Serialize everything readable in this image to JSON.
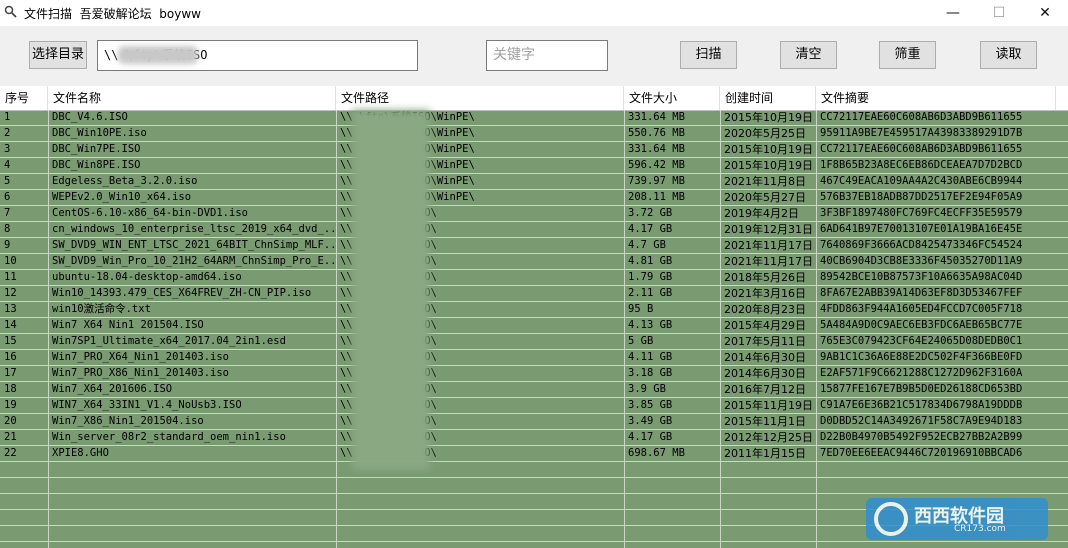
{
  "window": {
    "title": "文件扫描  吾爱破解论坛  boyww",
    "minimize": "—",
    "maximize": "☐",
    "close": "✕"
  },
  "toolbar": {
    "select_dir": "选择目录",
    "path_value": "\\\\            \\ftp\\系统ISO",
    "keyword_placeholder": "关键字",
    "scan": "扫描",
    "clear": "清空",
    "filter": "筛重",
    "read": "读取"
  },
  "table": {
    "columns": [
      "序号",
      "文件名称",
      "文件路径",
      "文件大小",
      "创建时间",
      "文件摘要"
    ],
    "rows": [
      [
        "1",
        "DBC_V4.6.ISO",
        "\\\\            \\ftp\\系统ISO\\WinPE\\",
        "331.64 MB",
        "2015年10月19日",
        "CC72117EAE60C608AB6D3ABD9B611655"
      ],
      [
        "2",
        "DBC_Win10PE.iso",
        "\\\\            \\ftp\\系统ISO\\WinPE\\",
        "550.76 MB",
        "2020年5月25日",
        "95911A9BE7E459517A43983389291D7B"
      ],
      [
        "3",
        "DBC_Win7PE.ISO",
        "\\\\            \\ftp\\系统ISO\\WinPE\\",
        "331.64 MB",
        "2015年10月19日",
        "CC72117EAE60C608AB6D3ABD9B611655"
      ],
      [
        "4",
        "DBC_Win8PE.ISO",
        "\\\\            \\ftp\\系统ISO\\WinPE\\",
        "596.42 MB",
        "2015年10月19日",
        "1F8B65B23A8EC6EB86DCEAEA7D7D2BCD"
      ],
      [
        "5",
        "Edgeless_Beta_3.2.0.iso",
        "\\\\            \\ftp\\系统ISO\\WinPE\\",
        "739.97 MB",
        "2021年11月8日",
        "467C49EACA109AA4A2C430ABE6CB9944"
      ],
      [
        "6",
        "WEPEv2.0_Win10_x64.iso",
        "\\\\            \\ftp\\系统ISO\\WinPE\\",
        "208.11 MB",
        "2020年5月27日",
        "576B37EB18ADB87DD2517EF2E94F05A9"
      ],
      [
        "7",
        "CentOS-6.10-x86_64-bin-DVD1.iso",
        "\\\\            \\ftp\\系统ISO\\",
        "3.72 GB",
        "2019年4月2日",
        "3F3BF1897480FC769FC4ECFF35E59579"
      ],
      [
        "8",
        "cn_windows_10_enterprise_ltsc_2019_x64_dvd_...",
        "\\\\            \\ftp\\系统ISO\\",
        "4.17 GB",
        "2019年12月31日",
        "6AD641B97E70013107E01A19BA16E45E"
      ],
      [
        "9",
        "SW_DVD9_WIN_ENT_LTSC_2021_64BIT_ChnSimp_MLF...",
        "\\\\            \\ftp\\系统ISO\\",
        "4.7 GB",
        "2021年11月17日",
        "7640869F3666ACD8425473346FC54524"
      ],
      [
        "10",
        "SW_DVD9_Win_Pro_10_21H2_64ARM_ChnSimp_Pro_E...",
        "\\\\            \\ftp\\系统ISO\\",
        "4.81 GB",
        "2021年11月17日",
        "40CB6904D3CB8E3336F45035270D11A9"
      ],
      [
        "11",
        "ubuntu-18.04-desktop-amd64.iso",
        "\\\\            \\ftp\\系统ISO\\",
        "1.79 GB",
        "2018年5月26日",
        "89542BCE10B87573F10A6635A98AC04D"
      ],
      [
        "12",
        "Win10_14393.479_CES_X64FREV_ZH-CN_PIP.iso",
        "\\\\            \\ftp\\系统ISO\\",
        "2.11 GB",
        "2021年3月16日",
        "8FA67E2ABB39A14D63EF8D3D53467FEF"
      ],
      [
        "13",
        "win10激活命令.txt",
        "\\\\            \\ftp\\系统ISO\\",
        "95 B",
        "2020年8月23日",
        "4FDD863F944A1605ED4FCCD7C005F718"
      ],
      [
        "14",
        "Win7 X64 Nin1 201504.ISO",
        "\\\\            \\ftp\\系统ISO\\",
        "4.13 GB",
        "2015年4月29日",
        "5A484A9D0C9AEC6EB3FDC6AEB65BC77E"
      ],
      [
        "15",
        "Win7SP1_Ultimate_x64_2017.04_2in1.esd",
        "\\\\            \\ftp\\系统ISO\\",
        "5 GB",
        "2017年5月11日",
        "765E3C079423CF64E24065D08DEDB0C1"
      ],
      [
        "16",
        "Win7_PRO_X64_Nin1_201403.iso",
        "\\\\            \\ftp\\系统ISO\\",
        "4.11 GB",
        "2014年6月30日",
        "9AB1C1C36A6E88E2DC502F4F366BE0FD"
      ],
      [
        "17",
        "Win7_PRO_X86_Nin1_201403.iso",
        "\\\\            \\ftp\\系统ISO\\",
        "3.18 GB",
        "2014年6月30日",
        "E2AF571F9C6621288C1272D962F3160A"
      ],
      [
        "18",
        "Win7_X64_201606.ISO",
        "\\\\            \\ftp\\系统ISO\\",
        "3.9 GB",
        "2016年7月12日",
        "15877FE167E7B9B5D0ED26188CD653BD"
      ],
      [
        "19",
        "WIN7_X64_33IN1_V1.4_NoUsb3.ISO",
        "\\\\            \\ftp\\系统ISO\\",
        "3.85 GB",
        "2015年11月19日",
        "C91A7E6E36B21C517834D6798A19DDDB"
      ],
      [
        "20",
        "Win7_X86_Nin1_201504.iso",
        "\\\\            \\ftp\\系统ISO\\",
        "3.49 GB",
        "2015年11月1日",
        "D0DBD52C14A3492671F58C7A9E94D183"
      ],
      [
        "21",
        "Win_server_08r2_standard_oem_nin1.iso",
        "\\\\            \\ftp\\系统ISO\\",
        "4.17 GB",
        "2012年12月25日",
        "D22B0B4970B5492F952ECB27BB2A2B99"
      ],
      [
        "22",
        "XPIE8.GHO",
        "\\\\            \\ftp\\系统ISO\\",
        "698.67 MB",
        "2011年1月15日",
        "7ED70EE6EEAC9446C720196910BBCAD6"
      ]
    ]
  },
  "watermark": {
    "text": "西西软件园",
    "sub": "CR173.com"
  }
}
